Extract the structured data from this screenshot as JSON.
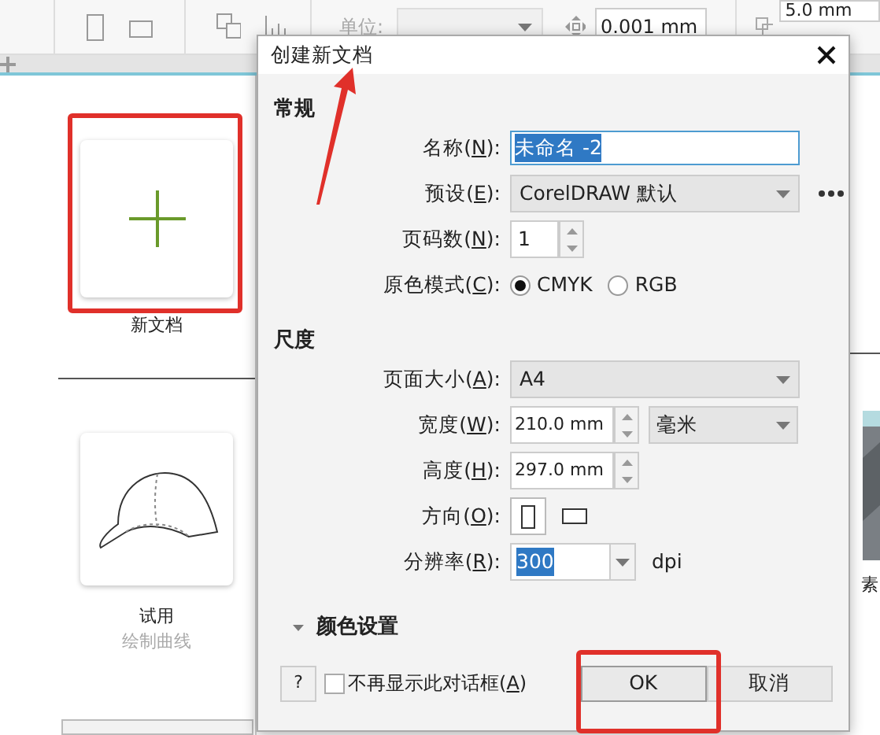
{
  "toolbar": {
    "unit_label": "单位:",
    "nudge": "0.001 mm",
    "duplicate_distance": "5.0 mm"
  },
  "welcome": {
    "new_document": "新文档",
    "template": {
      "title": "试用",
      "subtitle": "绘制曲线"
    },
    "cut_card_title": "素"
  },
  "dialog": {
    "title": "创建新文档",
    "general": {
      "heading": "常规",
      "rows": [
        {
          "kind": "text",
          "label_parts": [
            "名称(",
            "N",
            "):"
          ],
          "value": "未命名 -2",
          "highlighted": true
        },
        {
          "kind": "select",
          "label_parts": [
            "预设(",
            "E",
            "):"
          ],
          "value": "CorelDRAW 默认",
          "more": true
        },
        {
          "kind": "count",
          "label_parts": [
            "页码数(",
            "N",
            "):"
          ],
          "value": "1"
        },
        {
          "kind": "radio",
          "label_parts": [
            "原色模式(",
            "C",
            "):"
          ],
          "options": [
            {
              "label": "CMYK",
              "selected": true
            },
            {
              "label": "RGB",
              "selected": false
            }
          ]
        }
      ]
    },
    "dimensions": {
      "heading": "尺度",
      "rows": [
        {
          "kind": "select",
          "label_parts": [
            "页面大小(",
            "A",
            "):"
          ],
          "value": "A4",
          "more": false
        },
        {
          "kind": "measure",
          "label_parts": [
            "宽度(",
            "W",
            "):"
          ],
          "value": "210.0 mm",
          "unit": "毫米"
        },
        {
          "kind": "measure",
          "label_parts": [
            "高度(",
            "H",
            "):"
          ],
          "value": "297.0 mm"
        },
        {
          "kind": "orientation",
          "label_parts": [
            "方向(",
            "O",
            "):"
          ],
          "options": [
            {
              "kind": "portrait",
              "selected": true
            },
            {
              "kind": "landscape",
              "selected": false
            }
          ]
        },
        {
          "kind": "combo",
          "label_parts": [
            "分辨率(",
            "R",
            "):"
          ],
          "value": "300",
          "highlighted": true,
          "suffix": "dpi"
        }
      ]
    },
    "color_settings": {
      "heading": "颜色设置"
    },
    "help_button": "?",
    "dont_show": {
      "label_parts": [
        "不再显示此对话框(",
        "A",
        ")"
      ],
      "checked": false
    },
    "buttons": [
      {
        "label": "OK",
        "kind": "default"
      },
      {
        "label": "取消",
        "kind": "normal"
      }
    ]
  }
}
